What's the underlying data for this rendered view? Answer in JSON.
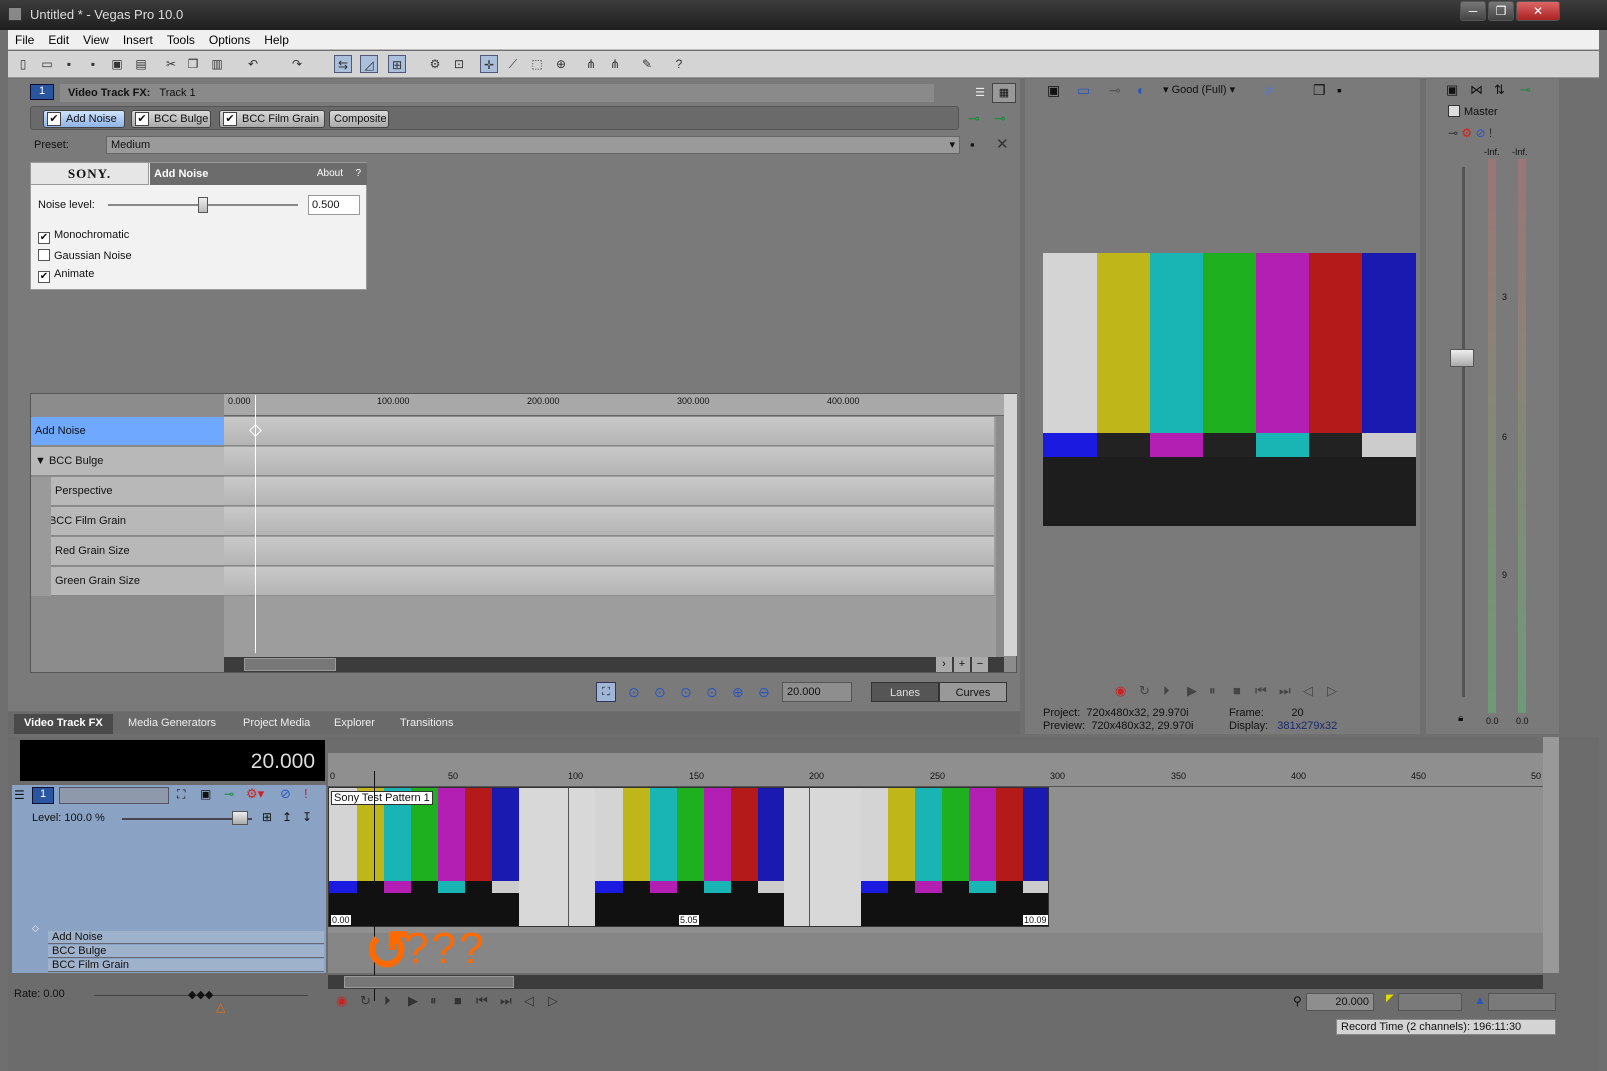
{
  "window": {
    "title": "Untitled * - Vegas Pro 10.0",
    "btns": [
      "─",
      "❐",
      "✕"
    ]
  },
  "menu": [
    "File",
    "Edit",
    "View",
    "Insert",
    "Tools",
    "Options",
    "Help"
  ],
  "fx": {
    "header_label": "Video Track FX:",
    "track_name": "Track 1",
    "track_num": "1",
    "chain": [
      {
        "label": "Add Noise",
        "checked": "✔"
      },
      {
        "label": "BCC Bulge",
        "checked": "✔"
      },
      {
        "label": "BCC Film Grain",
        "checked": "✔"
      },
      {
        "label": "Composite",
        "checked": ""
      }
    ],
    "preset_label": "Preset:",
    "preset_value": "Medium",
    "plugin": {
      "brand": "SONY.",
      "name": "Add Noise",
      "about": "About",
      "help": "?",
      "noise_label": "Noise level:",
      "noise_value": "0.500",
      "noise_fraction": 0.5,
      "checks": [
        {
          "label": "Monochromatic",
          "checked": "✔"
        },
        {
          "label": "Gaussian Noise",
          "checked": ""
        },
        {
          "label": "Animate",
          "checked": "✔"
        }
      ]
    }
  },
  "keyframes": {
    "ruler": [
      "0.000",
      "100.000",
      "200.000",
      "300.000",
      "400.000"
    ],
    "rows": [
      {
        "label": "Add Noise",
        "selected": true
      },
      {
        "label": "BCC Bulge",
        "expander": "▼"
      },
      {
        "label": "Perspective"
      },
      {
        "label": "BCC Film Grain",
        "expander": "▼"
      },
      {
        "label": "Red Grain Size"
      },
      {
        "label": "Green Grain Size"
      }
    ],
    "time_value": "20.000",
    "lanes_label": "Lanes",
    "curves_label": "Curves"
  },
  "tabs": [
    "Video Track FX",
    "Media Generators",
    "Project Media",
    "Explorer",
    "Transitions"
  ],
  "preview": {
    "quality": "Good (Full)",
    "project_label": "Project:",
    "project_value": "720x480x32, 29.970i",
    "preview_label": "Preview:",
    "preview_value": "720x480x32, 29.970i",
    "frame_label": "Frame:",
    "frame_value": "20",
    "display_label": "Display:",
    "display_value": "381x279x32"
  },
  "mixer": {
    "master_label": "Master",
    "inf_left": "-Inf.",
    "inf_right": "-Inf.",
    "scale": [
      "3",
      "6",
      "9"
    ],
    "zero_left": "0.0",
    "zero_right": "0.0"
  },
  "timeline": {
    "time": "20.000",
    "ruler": [
      "0",
      "50",
      "100",
      "150",
      "200",
      "250",
      "300",
      "350",
      "400",
      "450",
      "50"
    ],
    "track_num": "1",
    "level": "Level: 100.0 %",
    "clip_label": "Sony Test Pattern 1",
    "clip_times": [
      "0.00",
      "5.05",
      "10.09"
    ],
    "fx_list": [
      "Add Noise",
      "BCC Bulge",
      "BCC Film Grain"
    ],
    "annotation": "???",
    "rate": "Rate: 0.00",
    "bottom_time": "20.000",
    "status": "Record Time (2 channels): 196:11:30"
  },
  "colors": {
    "selected_blue": "#6ea9ff",
    "track_header": "#8aa3c4",
    "annotation": "#ff6a00"
  }
}
